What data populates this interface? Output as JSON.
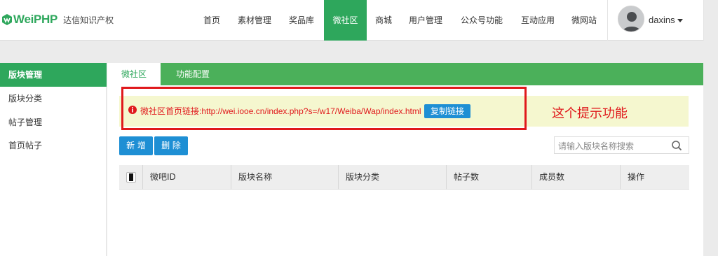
{
  "header": {
    "brand": "WeiPHP",
    "company": "达信知识产权",
    "nav": [
      "首页",
      "素材管理",
      "奖品库",
      "微社区",
      "商城",
      "用户管理",
      "公众号功能",
      "互动应用",
      "微网站"
    ],
    "active_nav": "微社区",
    "user": {
      "name": "daxins"
    }
  },
  "sidebar": {
    "items": [
      "版块管理",
      "版块分类",
      "帖子管理",
      "首页帖子"
    ],
    "active": "版块管理"
  },
  "tabs": [
    "微社区",
    "功能配置"
  ],
  "active_tab": "微社区",
  "notice": {
    "text": "微社区首页链接:http://wei.iooe.cn/index.php?s=/w17/Weiba/Wap/index.html",
    "copy_label": "复制链接"
  },
  "annotation": "这个提示功能",
  "toolbar": {
    "add_label": "新 增",
    "delete_label": "删 除"
  },
  "search": {
    "placeholder": "请输入版块名称搜索"
  },
  "table": {
    "columns": [
      "微吧ID",
      "版块名称",
      "版块分类",
      "帖子数",
      "成员数",
      "操作"
    ]
  },
  "colors": {
    "primary": "#2ea75c",
    "tab_bar": "#4bb05a",
    "button": "#1e8fd4",
    "alert": "#e0191c",
    "notice_bg": "#f5f7cf"
  }
}
